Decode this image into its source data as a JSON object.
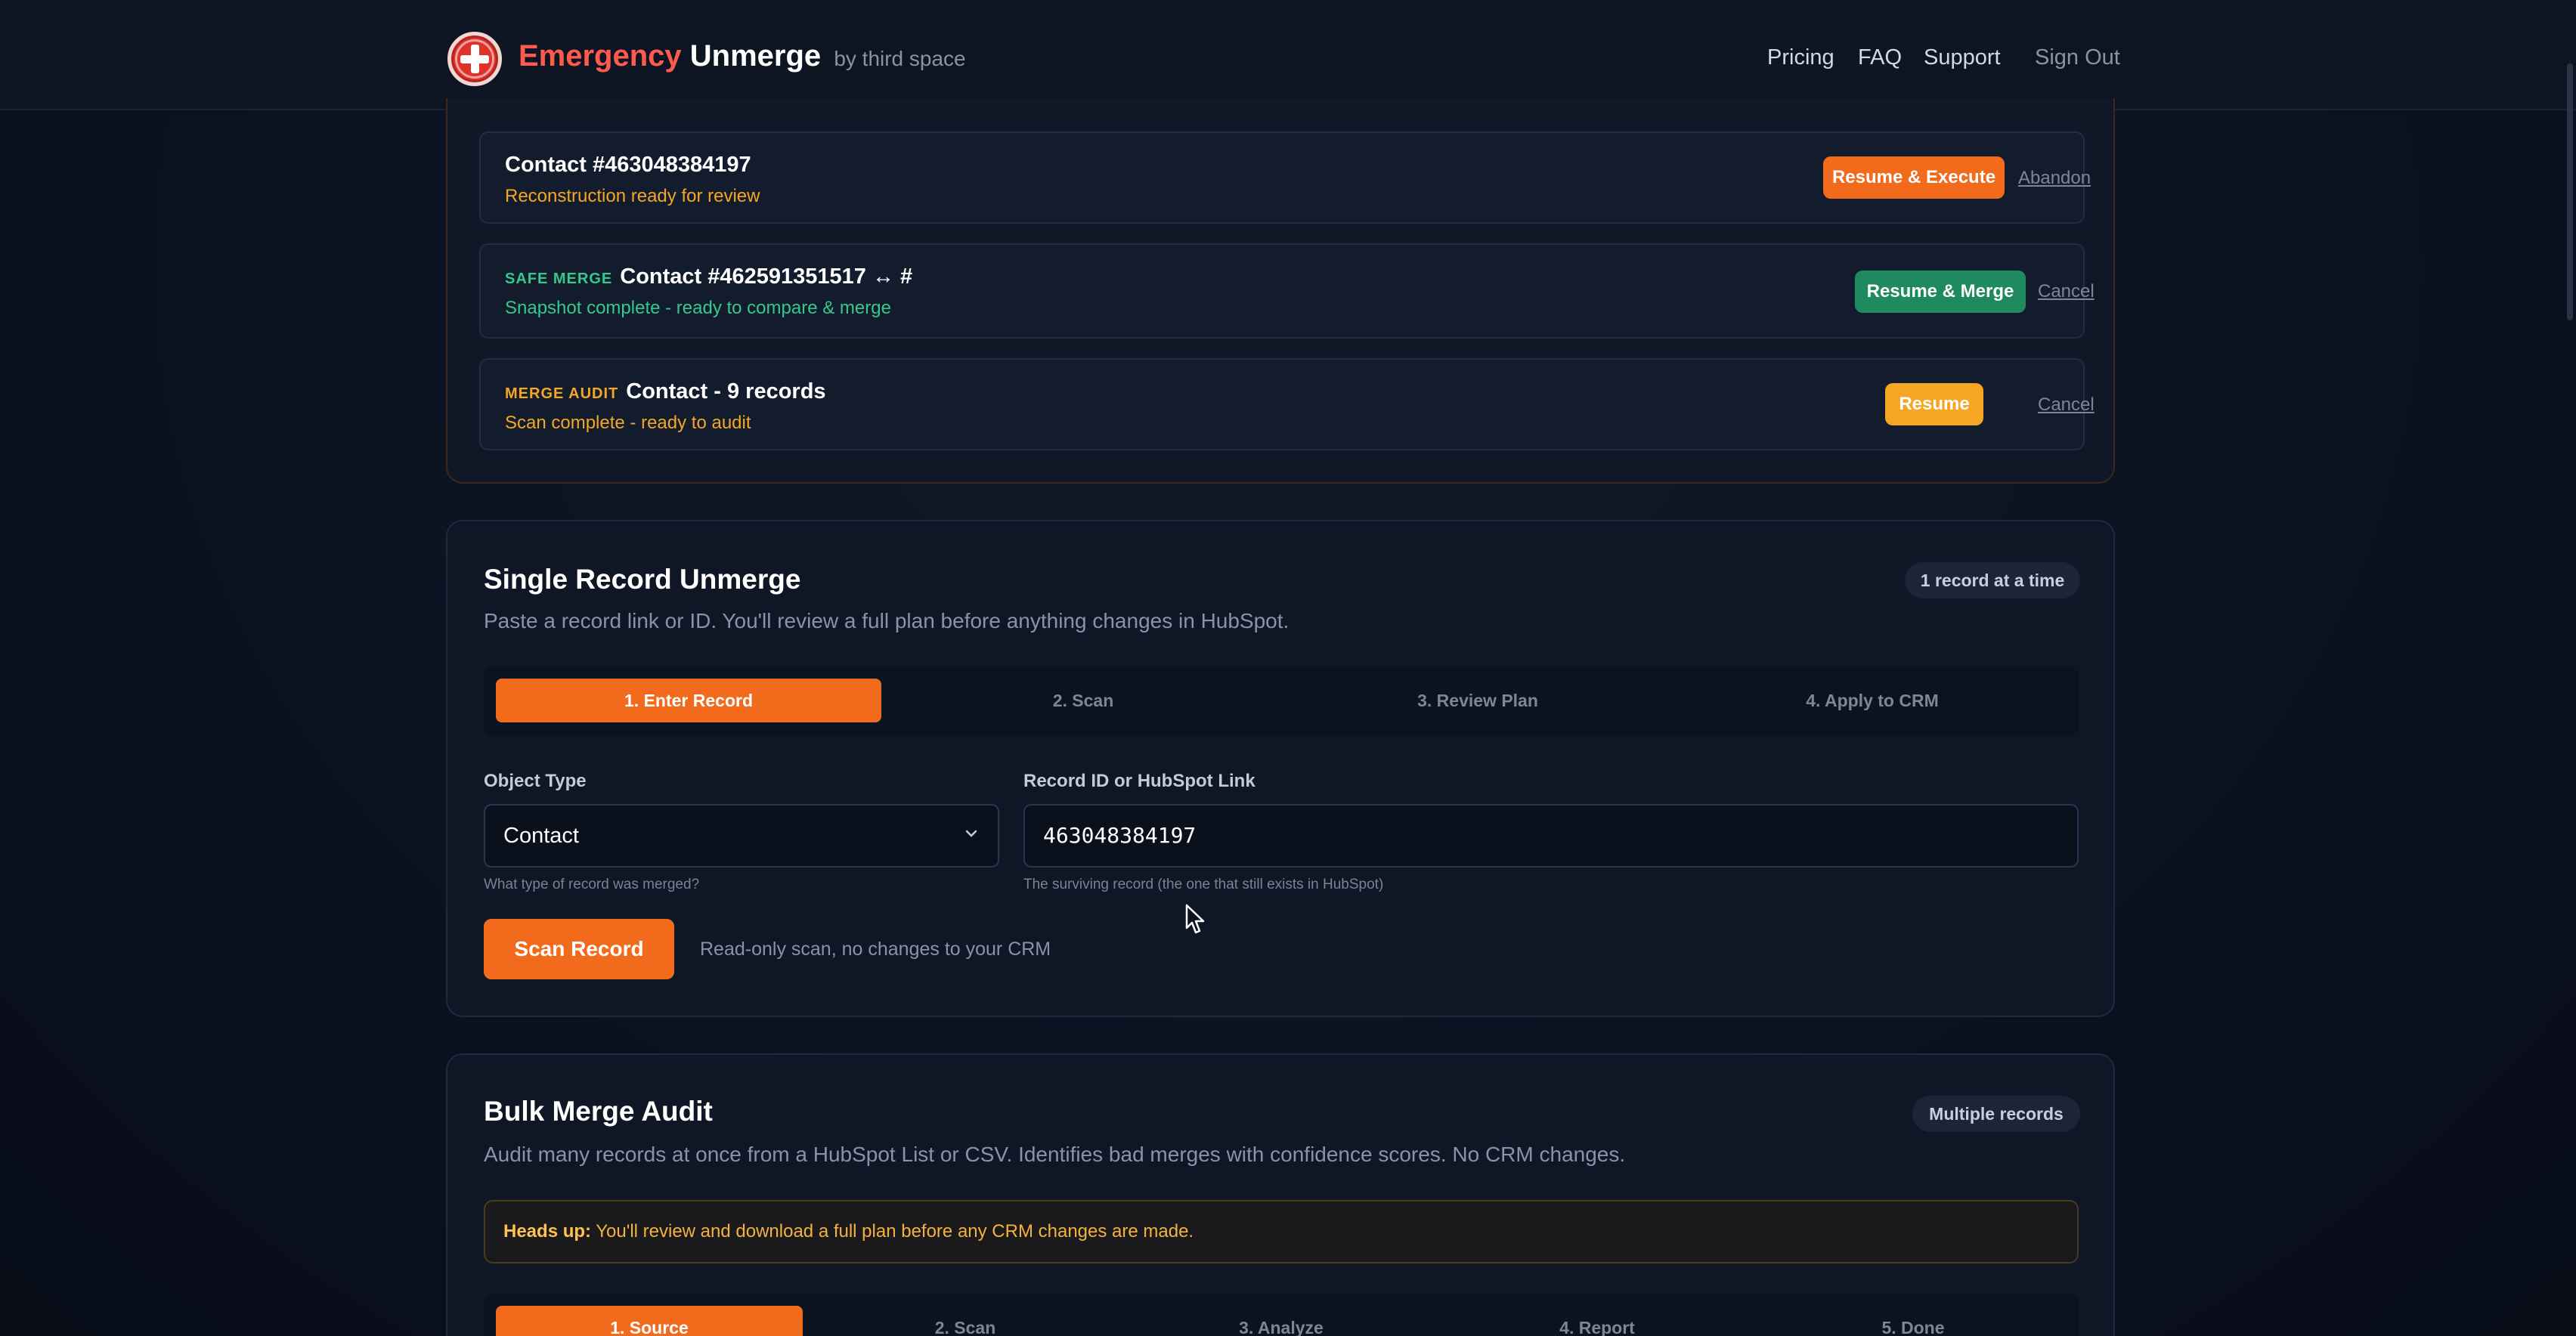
{
  "header": {
    "brand_1": "Emergency",
    "brand_2": "Unmerge",
    "brand_3": "by third space",
    "nav": [
      "Pricing",
      "FAQ",
      "Support"
    ],
    "sign_out": "Sign Out"
  },
  "resume": {
    "items": [
      {
        "tag": "",
        "title": "Contact #463048384197",
        "subtitle": "Reconstruction ready for review",
        "primary": "Resume & Execute",
        "secondary": "Abandon"
      },
      {
        "tag": "SAFE MERGE",
        "title": "Contact #462591351517 ↔ #",
        "subtitle": "Snapshot complete - ready to compare & merge",
        "primary": "Resume & Merge",
        "secondary": "Cancel"
      },
      {
        "tag": "MERGE AUDIT",
        "title": "Contact - 9 records",
        "subtitle": "Scan complete - ready to audit",
        "primary": "Resume",
        "secondary": "Cancel"
      }
    ]
  },
  "single": {
    "title": "Single Record Unmerge",
    "badge": "1 record at a time",
    "description": "Paste a record link or ID. You'll review a full plan before anything changes in HubSpot.",
    "steps": [
      "1. Enter Record",
      "2. Scan",
      "3. Review Plan",
      "4. Apply to CRM"
    ],
    "object_type_label": "Object Type",
    "object_type_value": "Contact",
    "object_type_hint": "What type of record was merged?",
    "record_label": "Record ID or HubSpot Link",
    "record_value": "463048384197",
    "record_hint": "The surviving record (the one that still exists in HubSpot)",
    "scan_button": "Scan Record",
    "scan_note": "Read-only scan, no changes to your CRM"
  },
  "bulk": {
    "title": "Bulk Merge Audit",
    "badge": "Multiple records",
    "description": "Audit many records at once from a HubSpot List or CSV. Identifies bad merges with confidence scores. No CRM changes.",
    "heads_up_label": "Heads up:",
    "heads_up_text": " You'll review and download a full plan before any CRM changes are made.",
    "steps": [
      "1. Source",
      "2. Scan",
      "3. Analyze",
      "4. Report",
      "5. Done"
    ]
  },
  "colors": {
    "orange": "#f26b1d",
    "green": "#1f8a5f",
    "amber": "#f5a623",
    "tag_green": "#37c98a",
    "tag_amber": "#f5a623"
  }
}
